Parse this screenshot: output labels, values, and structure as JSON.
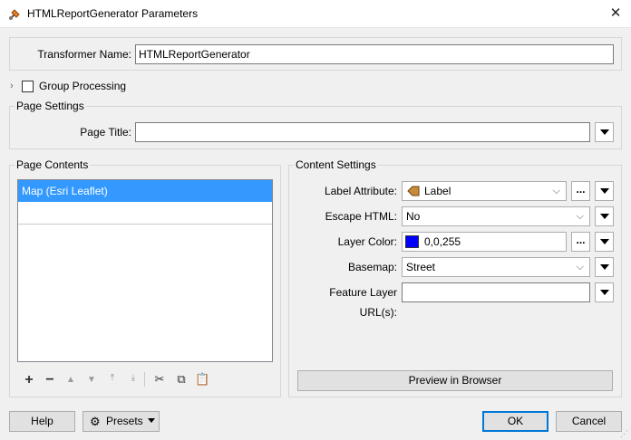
{
  "window": {
    "title": "HTMLReportGenerator Parameters"
  },
  "transformer": {
    "label": "Transformer Name:",
    "value": "HTMLReportGenerator"
  },
  "group_processing": {
    "label": "Group Processing"
  },
  "page_settings": {
    "legend": "Page Settings",
    "page_title_label": "Page Title:",
    "page_title_value": ""
  },
  "page_contents": {
    "legend": "Page Contents",
    "items": [
      {
        "label": "Map (Esri Leaflet)"
      }
    ]
  },
  "content_settings": {
    "legend": "Content Settings",
    "label_attribute": {
      "label": "Label Attribute:",
      "value": "Label"
    },
    "escape_html": {
      "label": "Escape HTML:",
      "value": "No"
    },
    "layer_color": {
      "label": "Layer Color:",
      "value": "0,0,255",
      "swatch": "#0000ff"
    },
    "basemap": {
      "label": "Basemap:",
      "value": "Street"
    },
    "feature_layer_urls": {
      "label": "Feature Layer URL(s):",
      "value": ""
    },
    "preview_label": "Preview in Browser"
  },
  "footer": {
    "help_label": "Help",
    "presets_label": "Presets",
    "ok_label": "OK",
    "cancel_label": "Cancel"
  },
  "colors": {
    "selection": "#3399ff",
    "accent": "#0078d7"
  }
}
